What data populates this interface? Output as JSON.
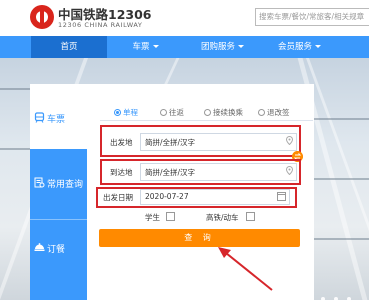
{
  "header": {
    "brand_cn": "中国铁路12306",
    "brand_en": "12306 CHINA RAILWAY",
    "search_placeholder": "搜索车票/餐饮/常旅客/相关规章"
  },
  "nav": {
    "items": [
      {
        "label": "首页",
        "active": true
      },
      {
        "label": "车票",
        "dropdown": true
      },
      {
        "label": "团购服务",
        "dropdown": true
      },
      {
        "label": "会员服务",
        "dropdown": true
      }
    ]
  },
  "sidebar": {
    "items": [
      {
        "label": "车票",
        "icon": "train-icon",
        "active": true
      },
      {
        "label": "常用查询",
        "icon": "query-icon",
        "active": false
      },
      {
        "label": "订餐",
        "icon": "meal-icon",
        "active": false
      }
    ]
  },
  "tabs": [
    {
      "label": "单程",
      "active": true
    },
    {
      "label": "往返",
      "active": false
    },
    {
      "label": "接续换乘",
      "active": false
    },
    {
      "label": "退改签",
      "active": false
    }
  ],
  "form": {
    "from_label": "出发地",
    "from_placeholder": "简拼/全拼/汉字",
    "to_label": "到达地",
    "to_placeholder": "简拼/全拼/汉字",
    "date_label": "出发日期",
    "date_value": "2020-07-27",
    "student_label": "学生",
    "gaotie_label": "高铁/动车",
    "query_label": "查 询"
  },
  "colors": {
    "nav_blue": "#3b99fc",
    "nav_active": "#1b6fd0",
    "orange": "#ff8a00",
    "annotation_red": "#d6262b"
  }
}
